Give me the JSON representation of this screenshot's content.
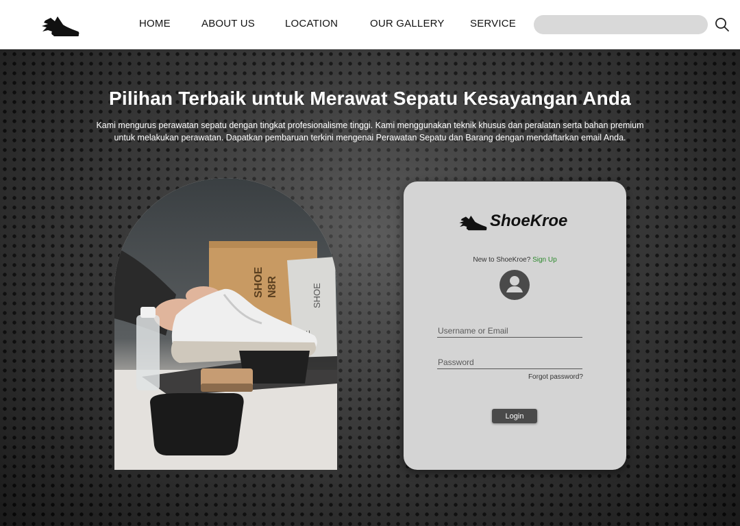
{
  "nav": {
    "logo_icon": "running-shoe-icon",
    "items": [
      "HOME",
      "ABOUT US",
      "LOCATION",
      "OUR GALLERY",
      "SERVICE"
    ],
    "search_placeholder": "",
    "search_icon": "search-icon"
  },
  "hero": {
    "title": "Pilihan Terbaik untuk Merawat Sepatu Kesayangan Anda",
    "description": "Kami mengurus perawatan sepatu dengan tingkat profesionalisme tinggi. Kami menggunakan teknik khusus dan peralatan serta bahan premium untuk melakukan perawatan. Dapatkan pembaruan terkini mengenai Perawatan Sepatu dan Barang dengan mendaftarkan email Anda."
  },
  "photo": {
    "box_text_1": "SHOE",
    "box_text_2": "N8R",
    "bag_text_1": "SHOE",
    "bag_text_2": "RE"
  },
  "login": {
    "brand": "ShoeKroe",
    "signup_prompt": "New to ShoeKroe?",
    "signup_link": "Sign Up",
    "avatar_icon": "user-avatar-icon",
    "username_placeholder": "Username or Email",
    "password_placeholder": "Password",
    "forgot": "Forgot password?",
    "login_button": "Login"
  },
  "colors": {
    "navbar_bg": "#ffffff",
    "hero_bg": "#3a3a3a",
    "card_bg": "#d4d4d4",
    "button_bg": "#4a4a4a",
    "link": "#2e8a2e"
  }
}
